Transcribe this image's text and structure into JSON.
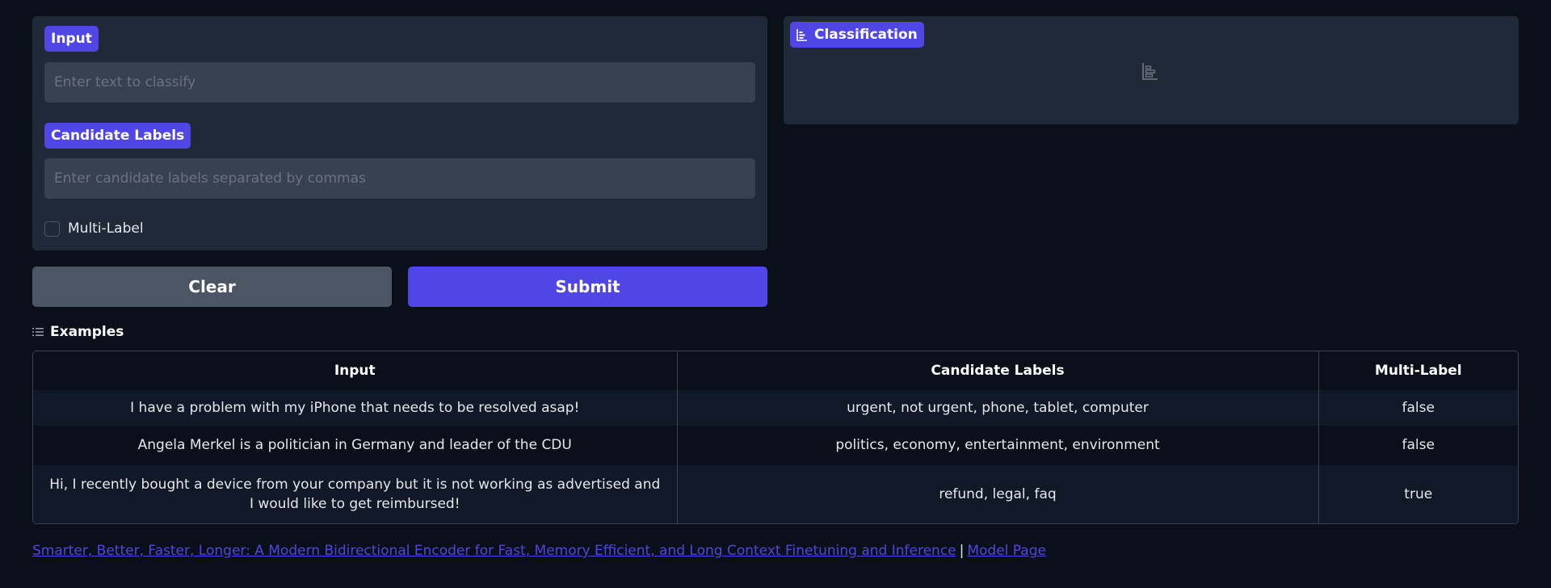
{
  "input_section": {
    "label": "Input",
    "placeholder": "Enter text to classify",
    "value": ""
  },
  "candidate_section": {
    "label": "Candidate Labels",
    "placeholder": "Enter candidate labels separated by commas",
    "value": ""
  },
  "multi_label": {
    "label": "Multi-Label",
    "checked": false
  },
  "buttons": {
    "clear": "Clear",
    "submit": "Submit"
  },
  "output": {
    "label": "Classification",
    "icon": "bar-chart-icon"
  },
  "examples": {
    "heading": "Examples",
    "columns": [
      "Input",
      "Candidate Labels",
      "Multi-Label"
    ],
    "rows": [
      [
        "I have a problem with my iPhone that needs to be resolved asap!",
        "urgent, not urgent, phone, tablet, computer",
        "false"
      ],
      [
        "Angela Merkel is a politician in Germany and leader of the CDU",
        "politics, economy, entertainment, environment",
        "false"
      ],
      [
        "Hi, I recently bought a device from your company but it is not working as advertised and I would like to get reimbursed!",
        "refund, legal, faq",
        "true"
      ]
    ]
  },
  "footer": {
    "paper_link": "Smarter, Better, Faster, Longer: A Modern Bidirectional Encoder for Fast, Memory Efficient, and Long Context Finetuning and Inference",
    "separator": "|",
    "model_link": "Model Page"
  },
  "colors": {
    "accent": "#4f46e5",
    "background": "#0b0f19",
    "panel": "#1f2937",
    "input_bg": "#374151",
    "secondary_button": "#4b5563"
  }
}
